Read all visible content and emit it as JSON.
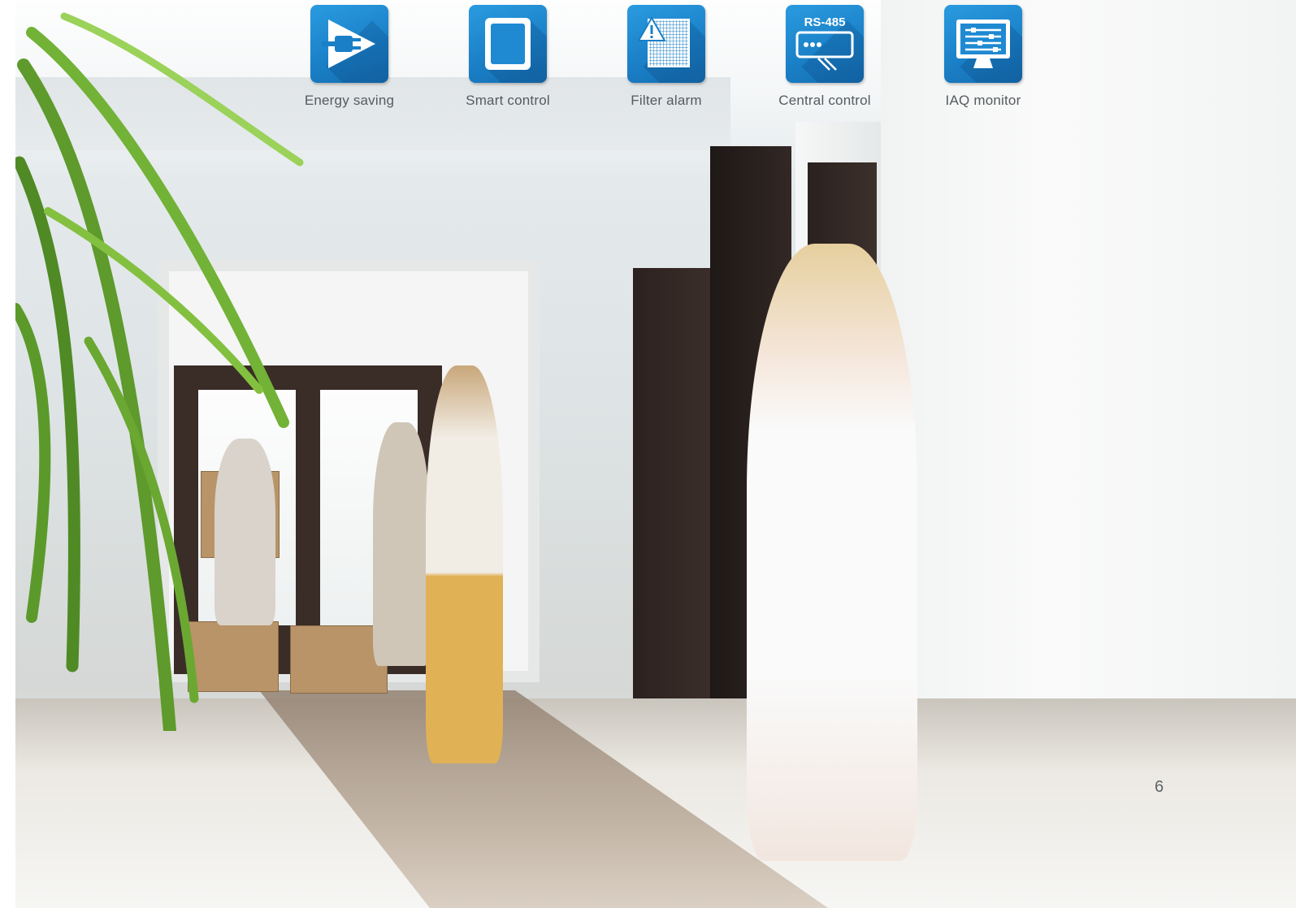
{
  "features": [
    {
      "label": "Energy saving",
      "icon": "plug-play-icon"
    },
    {
      "label": "Smart control",
      "icon": "tablet-icon"
    },
    {
      "label": "Filter alarm",
      "icon": "filter-warning-icon"
    },
    {
      "label": "Central control",
      "icon": "rs485-controller-icon",
      "icon_text": "RS-485"
    },
    {
      "label": "IAQ monitor",
      "icon": "monitor-sliders-icon"
    }
  ],
  "page_number": "6",
  "colors": {
    "tile_blue": "#1a7fc6",
    "label_gray": "#555b60"
  }
}
